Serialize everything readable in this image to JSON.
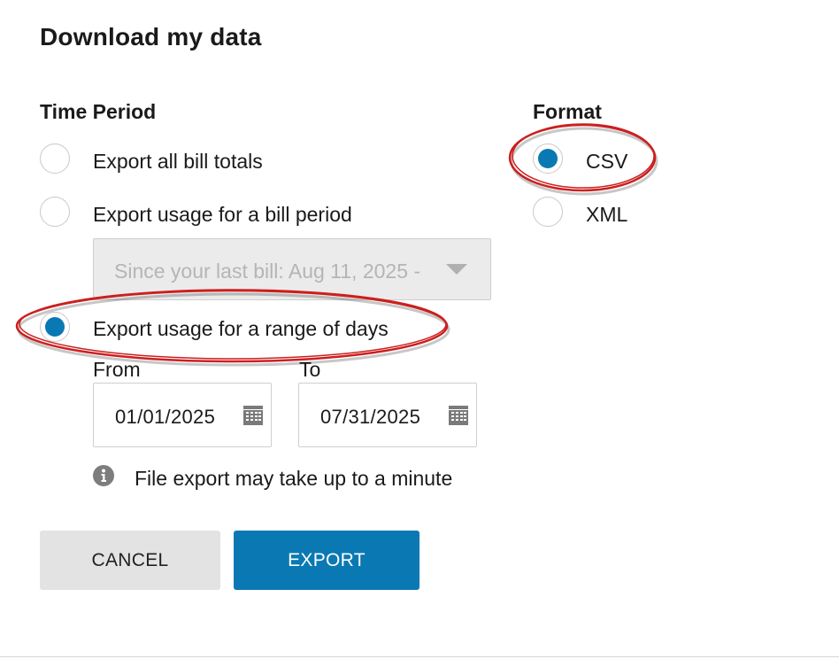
{
  "dialog": {
    "title": "Download my data"
  },
  "time_period": {
    "heading": "Time Period",
    "options": [
      {
        "label": "Export all bill totals",
        "checked": false
      },
      {
        "label": "Export usage for a bill period",
        "checked": false
      },
      {
        "label": "Export usage for a range of days",
        "checked": true
      }
    ],
    "bill_period_select": {
      "value": "Since your last bill: Aug 11, 2025 -",
      "disabled": true
    },
    "from_label": "From",
    "to_label": "To",
    "from_value": "01/01/2025",
    "to_value": "07/31/2025"
  },
  "format": {
    "heading": "Format",
    "options": [
      {
        "label": "CSV",
        "checked": true
      },
      {
        "label": "XML",
        "checked": false
      }
    ]
  },
  "info": {
    "icon": "info-icon",
    "text": "File export may take up to a minute"
  },
  "buttons": {
    "cancel": "CANCEL",
    "export": "EXPORT"
  },
  "colors": {
    "accent": "#0a79b3",
    "annotation": "#cc1f1f"
  }
}
